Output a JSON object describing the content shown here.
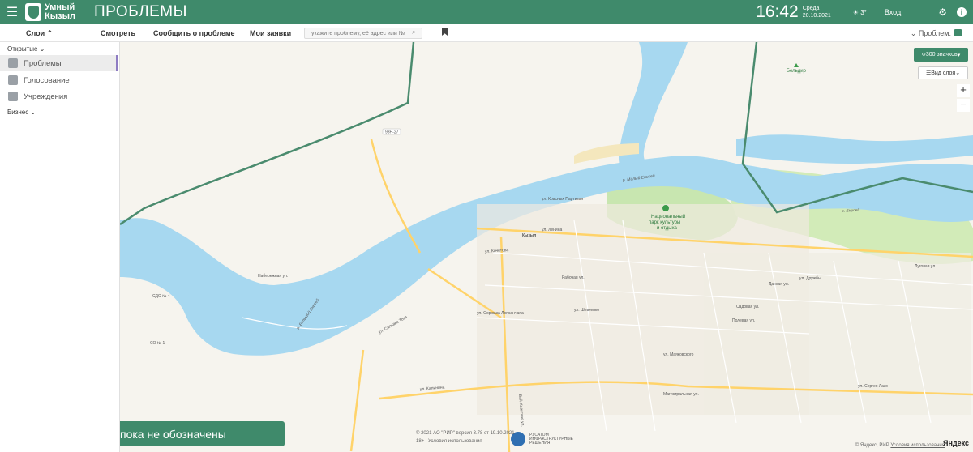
{
  "header": {
    "brand_line1": "Умный",
    "brand_line2": "Кызыл",
    "title": "ПРОБЛЕМЫ",
    "time": "16:42",
    "day": "Среда",
    "date": "20.10.2021",
    "temperature": "3°",
    "login": "Вход",
    "menu_icon": "hamburger-icon",
    "settings_icon": "gear-icon"
  },
  "toolbar": {
    "layers": "Слои",
    "view": "Смотреть",
    "report": "Сообщить о проблеме",
    "my_requests": "Мои заявки",
    "search_placeholder": "укажите проблему, её адрес или №",
    "filter_label": "Проблем:"
  },
  "sidebar": {
    "open_section": "Открытые",
    "items": [
      {
        "label": "Проблемы",
        "icon": "problems-icon",
        "active": true
      },
      {
        "label": "Голосование",
        "icon": "voting-icon",
        "active": false
      },
      {
        "label": "Учреждения",
        "icon": "institutions-icon",
        "active": false
      }
    ],
    "business_section": "Бизнес"
  },
  "map": {
    "count_button": "300 значков",
    "layer_button": "Вид слоя",
    "zoom_in": "+",
    "zoom_out": "−",
    "banner": "пока не обозначены",
    "city": "Кызыл",
    "park": "Национальный",
    "park2": "парк культуры",
    "park3": "и отдыха",
    "belдыр": "Бельдир",
    "river1": "р. Малый Енисей",
    "river2": "р. Большой Енисей",
    "river3": "р. Енисей",
    "road_label": "93Н-27",
    "copyright": "© 2021 АО \"РИР\" версия 3.78 от 19.10.2021",
    "terms": "Условия использования",
    "yandex_copy": "© Яндекс, РИР",
    "yandex_terms": "Условия использования",
    "yandex_logo": "Яндекс",
    "age": "18+",
    "rosatom": "РУСАТОМ ИНФРАСТРУКТУРНЫЕ РЕШЕНИЯ",
    "streets": [
      "ул. Кочетова",
      "ул. Ленина",
      "ул. Красных Партизан",
      "Рабочая ул.",
      "ул. Ооржака Лопсанчапа",
      "ул. Калинина",
      "Магистральная ул.",
      "ул. Сергея Лазо",
      "ул. Дружбы",
      "Набережная ул.",
      "ул. Салчака Тока",
      "ул. Шевченко",
      "ул. Маяковского",
      "Бай-Хаакская ул.",
      "Луговая ул.",
      "Полевая ул.",
      "Садовая ул.",
      "Дачная ул."
    ],
    "districts": [
      "СДО № 4",
      "СО № 1"
    ]
  }
}
